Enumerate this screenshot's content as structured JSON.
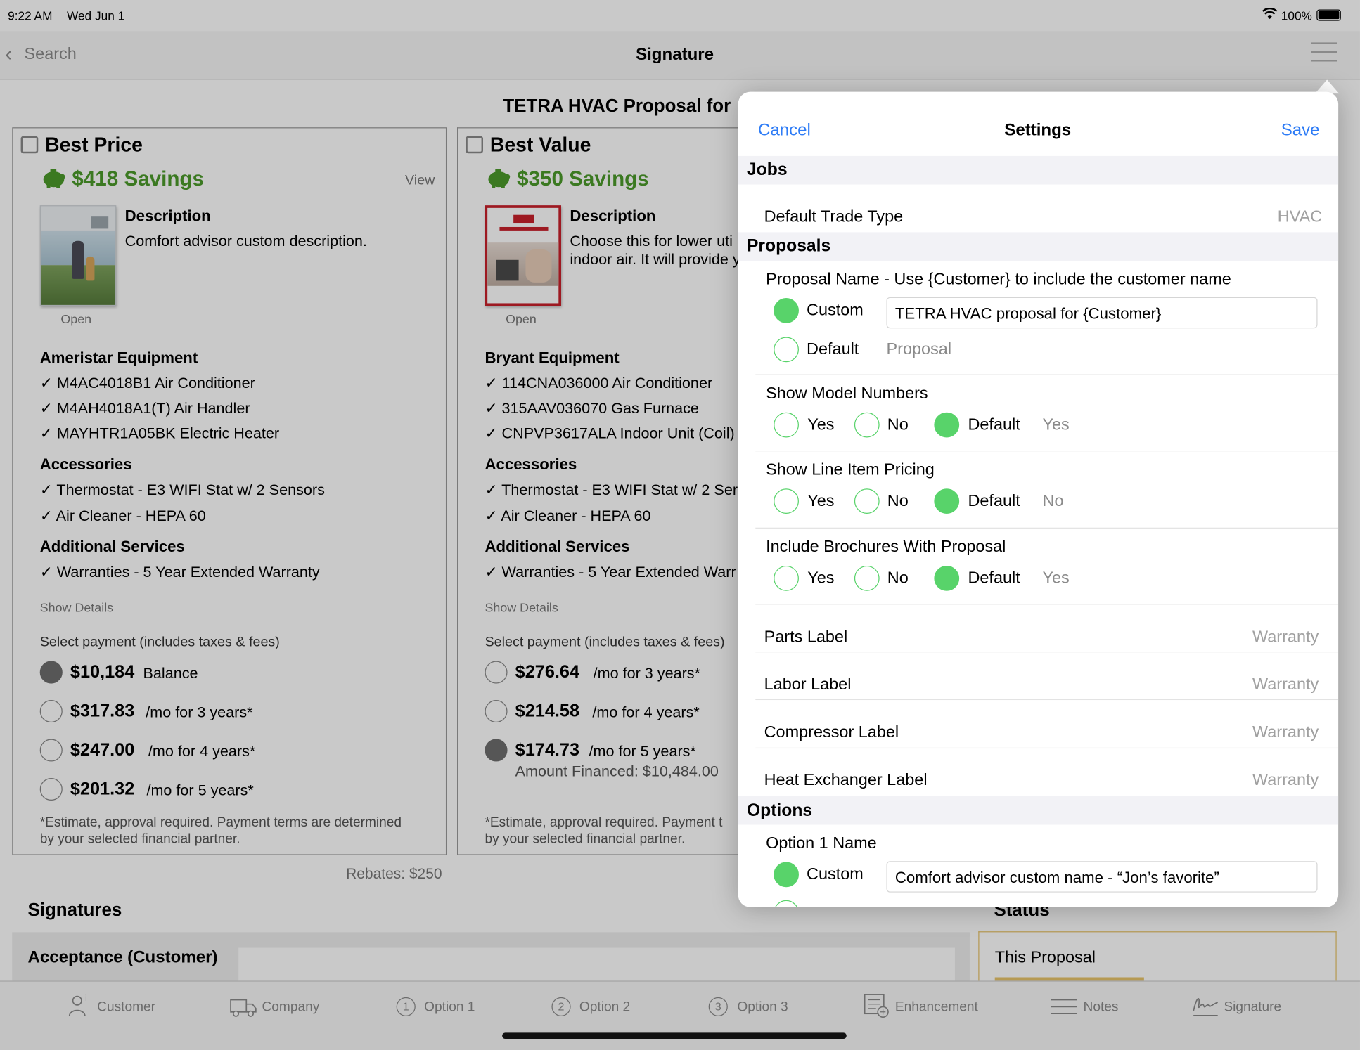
{
  "status_bar": {
    "time": "9:22 AM",
    "date": "Wed Jun 1",
    "battery": "100%"
  },
  "nav": {
    "back_label": "Search",
    "title": "Signature"
  },
  "proposal_title": "TETRA HVAC Proposal for",
  "options": [
    {
      "name": "Best Price",
      "savings": "$418 Savings",
      "view_label": "View",
      "open_label": "Open",
      "description_heading": "Description",
      "description_line1": "Comfort advisor custom description.",
      "description_line2": "",
      "equipment_heading": "Ameristar Equipment",
      "equipment": [
        "✓ M4AC4018B1 Air Conditioner",
        "✓ M4AH4018A1(T) Air Handler",
        "✓ MAYHTR1A05BK Electric Heater"
      ],
      "accessories_heading": "Accessories",
      "accessories": [
        "✓ Thermostat - E3 WIFI Stat w/ 2 Sensors",
        "✓ Air Cleaner - HEPA 60"
      ],
      "services_heading": "Additional Services",
      "services": [
        "✓ Warranties - 5 Year Extended Warranty"
      ],
      "show_details": "Show Details",
      "payment_heading": "Select payment (includes taxes & fees)",
      "payments": [
        {
          "price": "$10,184",
          "term": "Balance",
          "selected": true
        },
        {
          "price": "$317.83",
          "term": "/mo for 3 years*",
          "selected": false
        },
        {
          "price": "$247.00",
          "term": "/mo for 4 years*",
          "selected": false
        },
        {
          "price": "$201.32",
          "term": "/mo for 5 years*",
          "selected": false
        }
      ],
      "amount_financed": "",
      "disclaimer_line1": "*Estimate, approval required. Payment terms are determined",
      "disclaimer_line2": "by your selected financial partner."
    },
    {
      "name": "Best Value",
      "savings": "$350 Savings",
      "view_label": "",
      "open_label": "Open",
      "description_heading": "Description",
      "description_line1": "Choose this for lower uti",
      "description_line2": "indoor air. It will provide y",
      "equipment_heading": "Bryant Equipment",
      "equipment": [
        "✓ 114CNA036000 Air Conditioner",
        "✓ 315AAV036070 Gas Furnace",
        "✓ CNPVP3617ALA Indoor Unit (Coil)"
      ],
      "accessories_heading": "Accessories",
      "accessories": [
        "✓ Thermostat - E3 WIFI Stat w/ 2 Ser",
        "✓ Air Cleaner - HEPA 60"
      ],
      "services_heading": "Additional Services",
      "services": [
        "✓ Warranties - 5 Year Extended Warr"
      ],
      "show_details": "Show Details",
      "payment_heading": "Select payment (includes taxes & fees)",
      "payments": [
        {
          "price": "$276.64",
          "term": "/mo for 3 years*",
          "selected": false
        },
        {
          "price": "$214.58",
          "term": "/mo for 4 years*",
          "selected": false
        },
        {
          "price": "$174.73",
          "term": "/mo for 5 years*",
          "selected": true
        }
      ],
      "amount_financed": "Amount Financed: $10,484.00",
      "disclaimer_line1": "*Estimate, approval required. Payment t",
      "disclaimer_line2": "by your selected financial partner."
    }
  ],
  "rebates": "Rebates: $250",
  "signatures": {
    "heading": "Signatures",
    "acceptance_label": "Acceptance (Customer)"
  },
  "status": {
    "heading": "Status",
    "item": "This Proposal"
  },
  "tabs": [
    {
      "label": "Customer",
      "icon": "customer-icon"
    },
    {
      "label": "Company",
      "icon": "truck-icon"
    },
    {
      "label": "Option 1",
      "num": "1"
    },
    {
      "label": "Option 2",
      "num": "2"
    },
    {
      "label": "Option 3",
      "num": "3"
    },
    {
      "label": "Enhancement",
      "icon": "enhancement-icon"
    },
    {
      "label": "Notes",
      "icon": "notes-icon"
    },
    {
      "label": "Signature",
      "icon": "signature-icon"
    }
  ],
  "settings": {
    "cancel": "Cancel",
    "title": "Settings",
    "save": "Save",
    "jobs_heading": "Jobs",
    "default_trade_type_label": "Default Trade Type",
    "default_trade_type_value": "HVAC",
    "proposals_heading": "Proposals",
    "proposal_name_label": "Proposal Name - Use {Customer} to include the customer name",
    "custom_label": "Custom",
    "custom_value": "TETRA HVAC proposal for {Customer}",
    "default_label": "Default",
    "default_value": "Proposal",
    "show_model_numbers": {
      "label": "Show Model Numbers",
      "yes": "Yes",
      "no": "No",
      "default": "Default",
      "default_value": "Yes"
    },
    "show_line_item_pricing": {
      "label": "Show Line Item Pricing",
      "yes": "Yes",
      "no": "No",
      "default": "Default",
      "default_value": "No"
    },
    "include_brochures": {
      "label": "Include Brochures With Proposal",
      "yes": "Yes",
      "no": "No",
      "default": "Default",
      "default_value": "Yes"
    },
    "parts_label": "Parts Label",
    "parts_value": "Warranty",
    "labor_label": "Labor Label",
    "labor_value": "Warranty",
    "compressor_label": "Compressor Label",
    "compressor_value": "Warranty",
    "heat_exchanger_label": "Heat Exchanger Label",
    "heat_exchanger_value": "Warranty",
    "options_heading": "Options",
    "option1_name_label": "Option 1 Name",
    "option1_custom_label": "Custom",
    "option1_custom_value": "Comfort advisor custom name - “Jon’s favorite”"
  }
}
